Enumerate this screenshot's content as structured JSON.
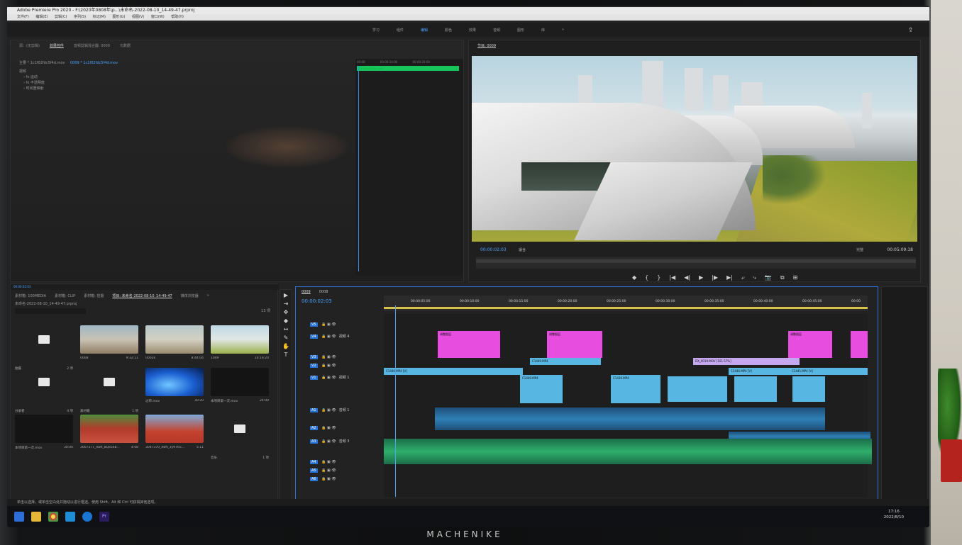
{
  "window": {
    "title": "Adobe Premiere Pro 2020 - F:\\2020年0808年\\p...\\未命名-2022-08-10_14-49-47.prproj"
  },
  "menu": [
    "文件(F)",
    "编辑(E)",
    "剪辑(C)",
    "序列(S)",
    "标记(M)",
    "图形(G)",
    "视图(V)",
    "窗口(W)",
    "帮助(H)"
  ],
  "workspaces": {
    "items": [
      "学习",
      "组件",
      "编辑",
      "颜色",
      "效果",
      "音频",
      "图形",
      "库",
      "»"
    ],
    "active": "编辑"
  },
  "source_panel": {
    "tabs": [
      "源：(无剪辑)",
      "效果控件",
      "音频剪辑混合器: 0009",
      "元数据"
    ],
    "active_tab": "效果控件",
    "clip_path": "主要 * 1c1f02fdc5f4d.mov",
    "sequence_path": "0009 * 1c1f02fdc5f4d.mov",
    "section": "视频",
    "tree": [
      "› fx 运动",
      "› fx 不透明度",
      "› 时间重映射"
    ],
    "mini_ruler": [
      "00:00",
      "00:00:10:00",
      "00:00:20:00"
    ],
    "mini_clip": "1c1f02fdc5f4d.mov"
  },
  "program_monitor": {
    "title": "节目: 0009",
    "timecode": "00:00:02:03",
    "fit": "适合",
    "quality": "完整",
    "duration": "00:05:09:18",
    "transport": [
      "◆",
      "{",
      "}",
      "|◀",
      "◀|",
      "▶",
      "|▶",
      "▶|",
      "⤶",
      "⤷",
      "📷",
      "⧉",
      "⊞"
    ]
  },
  "project_panel": {
    "header": "00:00:02:03",
    "tabs": [
      "素材箱: 100MEDIA",
      "素材箱: CLIP",
      "素材箱: 拍摄",
      "项目: 未命名-2022-08-10_14-49-47",
      "媒体浏览器",
      "»"
    ],
    "active_tab": "项目: 未命名-2022-08-10_14-49-47",
    "path": "未命名-2022-08-10_14-49-47.prproj",
    "count": "13 项",
    "items": [
      {
        "name": "拍摄",
        "meta": "2 项",
        "kind": "folder"
      },
      {
        "name": "0008",
        "meta": "9:32:11",
        "kind": "street"
      },
      {
        "name": "0002k",
        "meta": "8:44:04",
        "kind": "street2"
      },
      {
        "name": "1009",
        "meta": "10:19:20",
        "kind": "city"
      },
      {
        "name": "分录者",
        "meta": "4 项",
        "kind": "folder"
      },
      {
        "name": "素材箱",
        "meta": "1 项",
        "kind": "folder"
      },
      {
        "name": "过审.mov",
        "meta": "30:20",
        "kind": "bluefx"
      },
      {
        "name": "本项目第一次.mov",
        "meta": "24:00",
        "kind": "dark"
      },
      {
        "name": "本项目第一次.mov",
        "meta": "30:00",
        "kind": "dark"
      },
      {
        "name": "3007377_Xbft_8Qe54b...",
        "meta": "4:08",
        "kind": "temple"
      },
      {
        "name": "3047370_Xbft_3y9765...",
        "meta": "5:11",
        "kind": "temple2"
      },
      {
        "name": "音乐",
        "meta": "1 项",
        "kind": "folder"
      }
    ]
  },
  "tools": [
    "▶",
    "⇥",
    "✥",
    "◆",
    "↔",
    "✎",
    "✋",
    "T"
  ],
  "timeline": {
    "tabs": [
      "0009",
      "0008"
    ],
    "timecode": "00:00:02:03",
    "ruler": [
      "00:00:05:00",
      "00:00:10:00",
      "00:00:15:00",
      "00:00:20:00",
      "00:00:25:00",
      "00:00:30:00",
      "00:00:35:00",
      "00:00:40:00",
      "00:00:45:00",
      "00:00"
    ],
    "tracks": [
      {
        "id": "V5",
        "label": ""
      },
      {
        "id": "V4",
        "label": "视频 4"
      },
      {
        "id": "V3",
        "label": ""
      },
      {
        "id": "V2",
        "label": ""
      },
      {
        "id": "V1",
        "label": "视频 1"
      },
      {
        "id": "A1",
        "label": "音频 1"
      },
      {
        "id": "A2",
        "label": ""
      },
      {
        "id": "A3",
        "label": "音频 3"
      },
      {
        "id": "A4",
        "label": ""
      },
      {
        "id": "A5",
        "label": ""
      },
      {
        "id": "A6",
        "label": ""
      }
    ],
    "clips": [
      {
        "label": "调整图层",
        "color": "pink"
      },
      {
        "label": "调整图层",
        "color": "pink"
      },
      {
        "label": "调整图层",
        "color": "pink"
      },
      {
        "label": "C1449.MP4",
        "color": "blue"
      },
      {
        "label": "DX_0019.MOV [101.57%]",
        "color": "lav"
      },
      {
        "label": "C1446.MP4 [V]",
        "color": "blue"
      },
      {
        "label": "C1445.MP4 [V]",
        "color": "blue"
      },
      {
        "label": "C1440.MP4 [V]",
        "color": "blue"
      },
      {
        "label": "C1449.MP4",
        "color": "blue"
      },
      {
        "label": "C1439.MP4",
        "color": "blue"
      }
    ]
  },
  "status": "单击以选择，或单击空白处并拖动以进行框选。使用 Shift、Alt 和 Ctrl 可获得其他选项。",
  "taskbar": {
    "time": "17:16",
    "date": "2022/8/10"
  },
  "brand": "MACHENIKE",
  "colors": {
    "accent": "#4ba3ff",
    "adjustment": "#e74ee0",
    "video_clip": "#58b6e3",
    "audio_green": "#2fae6b",
    "effect_clip": "#18c55a"
  }
}
